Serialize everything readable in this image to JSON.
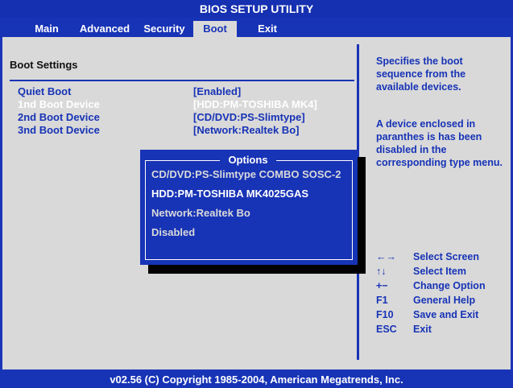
{
  "title": "BIOS SETUP UTILITY",
  "menu": [
    "Main",
    "Advanced",
    "Security",
    "Boot",
    "Exit"
  ],
  "active_menu": "Boot",
  "section_title": "Boot Settings",
  "settings": [
    {
      "label": "Quiet Boot",
      "value": "[Enabled]"
    },
    {
      "label": "1nd Boot Device",
      "value": "[HDD:PM-TOSHIBA MK4]"
    },
    {
      "label": "2nd Boot Device",
      "value": "[CD/DVD:PS-Slimtype]"
    },
    {
      "label": "3nd Boot Device",
      "value": "[Network:Realtek Bo]"
    }
  ],
  "help": {
    "line1": "Specifies the boot sequence from the available devices.",
    "line2": "A device enclosed in paranthes is has been disabled in the corresponding type menu."
  },
  "keys": [
    {
      "key": "←→",
      "desc": "Select Screen"
    },
    {
      "key": "↑↓",
      "desc": "Select Item"
    },
    {
      "key": "+−",
      "desc": "Change Option"
    },
    {
      "key": "F1",
      "desc": "General Help"
    },
    {
      "key": "F10",
      "desc": "Save and Exit"
    },
    {
      "key": "ESC",
      "desc": "Exit"
    }
  ],
  "dialog": {
    "title": "Options",
    "options": [
      "CD/DVD:PS-Slimtype COMBO SOSC-2",
      "HDD:PM-TOSHIBA MK4025GAS",
      "Network:Realtek Bo",
      "Disabled"
    ]
  },
  "footer": "v02.56 (C) Copyright  1985-2004, American Megatrends, Inc.",
  "colors": {
    "bios_blue": "#1733b6",
    "panel_gray": "#d9d9d9",
    "text_white": "#ffffff"
  }
}
